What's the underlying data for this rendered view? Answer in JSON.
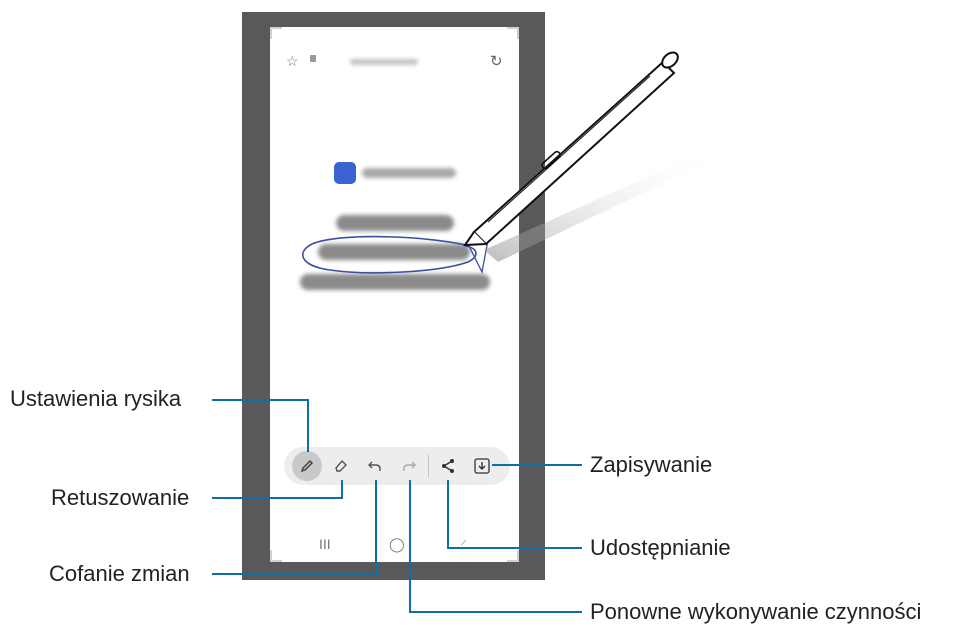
{
  "callouts": {
    "pen_settings": "Ustawienia rysika",
    "eraser": "Retuszowanie",
    "undo": "Cofanie zmian",
    "save": "Zapisywanie",
    "share": "Udostępnianie",
    "redo": "Ponowne wykonywanie czynności"
  },
  "toolbar": {
    "tools": [
      "pen-icon",
      "eraser-icon",
      "undo-icon",
      "redo-icon",
      "share-icon",
      "save-icon"
    ]
  },
  "navbar": {
    "recent_glyph": "III",
    "home_glyph": "◯"
  },
  "colors": {
    "accent_line": "#0d6fa6",
    "phone_frame": "#58595b",
    "handwriting": "#3a4fa0",
    "app_icon": "#3b63d1"
  }
}
